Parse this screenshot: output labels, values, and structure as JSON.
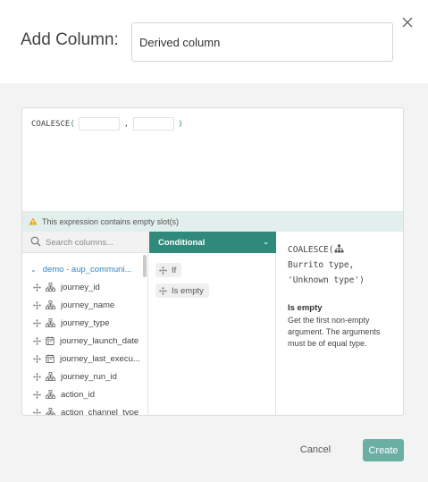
{
  "dialog": {
    "title": "Add Column:",
    "column_name_value": "Derived column",
    "close_icon": "close-icon"
  },
  "expression": {
    "function_name": "COALESCE",
    "open_paren": "(",
    "close_paren": ")",
    "separator": ",",
    "warning_text": "This expression contains empty slot(s)",
    "warning_icon": "warning-triangle-icon",
    "warning_color": "#e6a817"
  },
  "columns_panel": {
    "search_placeholder": "Search columns...",
    "group_label": "demo - aup_communi...",
    "fields": [
      {
        "label": "journey_id",
        "type_icon": "hierarchy-icon"
      },
      {
        "label": "journey_name",
        "type_icon": "hierarchy-icon"
      },
      {
        "label": "journey_type",
        "type_icon": "hierarchy-icon"
      },
      {
        "label": "journey_launch_date",
        "type_icon": "calendar-icon"
      },
      {
        "label": "journey_last_execu...",
        "type_icon": "calendar-icon"
      },
      {
        "label": "journey_run_id",
        "type_icon": "hierarchy-icon"
      },
      {
        "label": "action_id",
        "type_icon": "hierarchy-icon"
      },
      {
        "label": "action_channel_type",
        "type_icon": "hierarchy-icon"
      }
    ]
  },
  "functions_panel": {
    "category": "Conditional",
    "functions": [
      "If",
      "Is empty"
    ]
  },
  "docs_panel": {
    "code_fn": "COALESCE(",
    "code_arg1": "Burrito type,",
    "code_arg2": "'Unknown type')",
    "title": "Is empty",
    "description": "Get the first non-empty argument. The arguments must be of equal type."
  },
  "footer": {
    "cancel_label": "Cancel",
    "create_label": "Create"
  },
  "colors": {
    "accent": "#2f8a7a",
    "create_button": "#6aafa2",
    "link_blue": "#2e86c1",
    "warning_bg": "#e2efec"
  }
}
